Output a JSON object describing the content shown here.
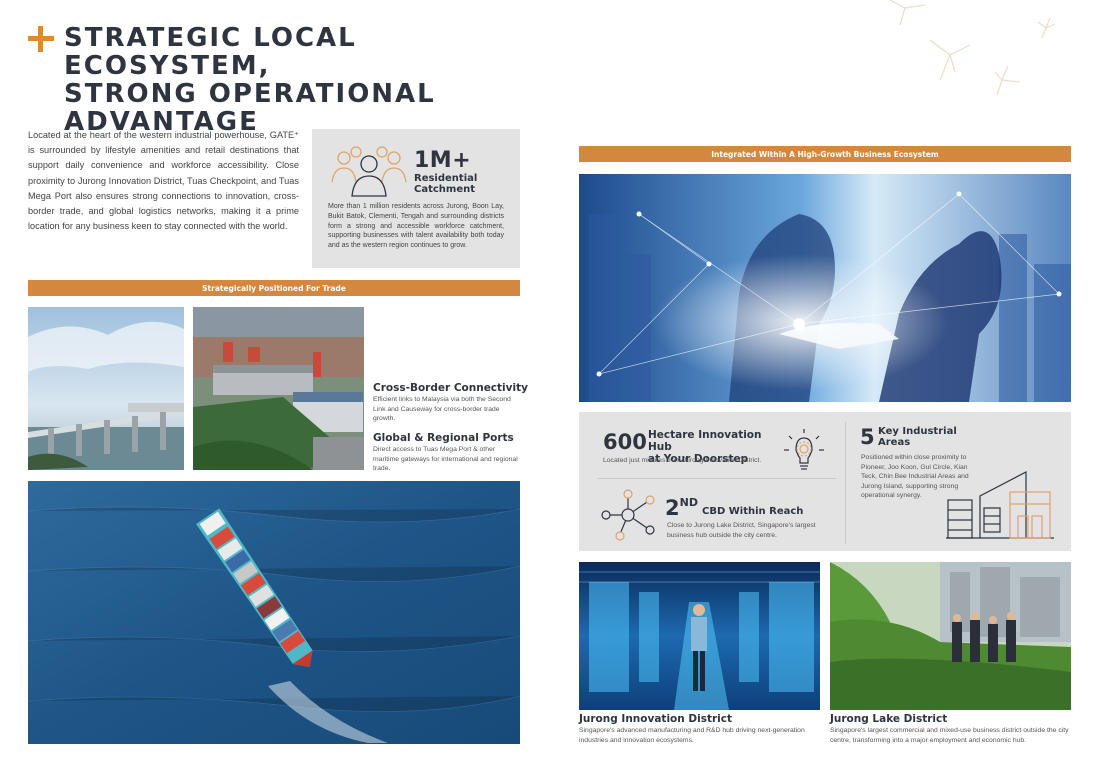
{
  "header": {
    "title_line1": "STRATEGIC LOCAL ECOSYSTEM,",
    "title_line2": "STRONG OPERATIONAL",
    "title_line3": "ADVANTAGE"
  },
  "intro": {
    "text": "Located at the heart of the western industrial powerhouse, GATE⁺ is surrounded by lifestyle amenities and retail destinations that support daily convenience and workforce accessibility. Close proximity to Jurong Innovation District, Tuas Checkpoint, and Tuas Mega Port also ensures strong connections to innovation, cross-border trade, and global logistics networks, making it a prime location for any business keen to stay connected with the world."
  },
  "catchment": {
    "value": "1M+",
    "label_line1": "Residential",
    "label_line2": "Catchment",
    "text": "More than 1 million residents across Jurong, Boon Lay, Bukit Batok, Clementi, Tengah and surrounding districts form a strong and accessible workforce catchment, supporting businesses with talent availability both today and as the western region continues to grow.",
    "icon": "people-group-icon"
  },
  "trade": {
    "bar_label": "Strategically Positioned For Trade",
    "items": [
      {
        "title": "Cross-Border Connectivity",
        "text": "Efficient links to Malaysia via both the Second Link and Causeway for cross-border trade growth."
      },
      {
        "title": "Global & Regional Ports",
        "text": "Direct access to Tuas Mega Port & other maritime gateways for international and regional trade."
      }
    ]
  },
  "ecosystem": {
    "bar_label": "Integrated Within A High-Growth Business Ecosystem",
    "hub": {
      "value": "600",
      "label_line1": "Hectare Innovation Hub",
      "label_line2": "at Your Doorstep",
      "text": "Located just minutes from Jurong Innovation District.",
      "icon": "lightbulb-gear-icon"
    },
    "cbd": {
      "value": "2",
      "superscript": "ND",
      "label": "CBD Within Reach",
      "text": "Close to Jurong Lake District, Singapore's largest business hub outside the city centre.",
      "icon": "network-nodes-icon"
    },
    "industrial": {
      "value": "5",
      "label_line1": "Key Industrial",
      "label_line2": "Areas",
      "text": "Positioned within close proximity to Pioneer, Joo Koon, Gul Circle, Kian Teck, Chin Bee Industrial Areas and Jurong Island, supporting strong operational synergy.",
      "icon": "industrial-buildings-icon"
    }
  },
  "districts": [
    {
      "title": "Jurong Innovation District",
      "text": "Singapore's advanced manufacturing and R&D hub driving next-generation industries and innovation ecosystems."
    },
    {
      "title": "Jurong Lake District",
      "text": "Singapore's largest commercial and mixed-use business district outside the city centre, transforming into a major employment and economic hub."
    }
  ],
  "colors": {
    "accent": "#d4883f",
    "plus": "#e08a2e",
    "heading": "#2e3540",
    "panel": "#e3e3e3"
  }
}
